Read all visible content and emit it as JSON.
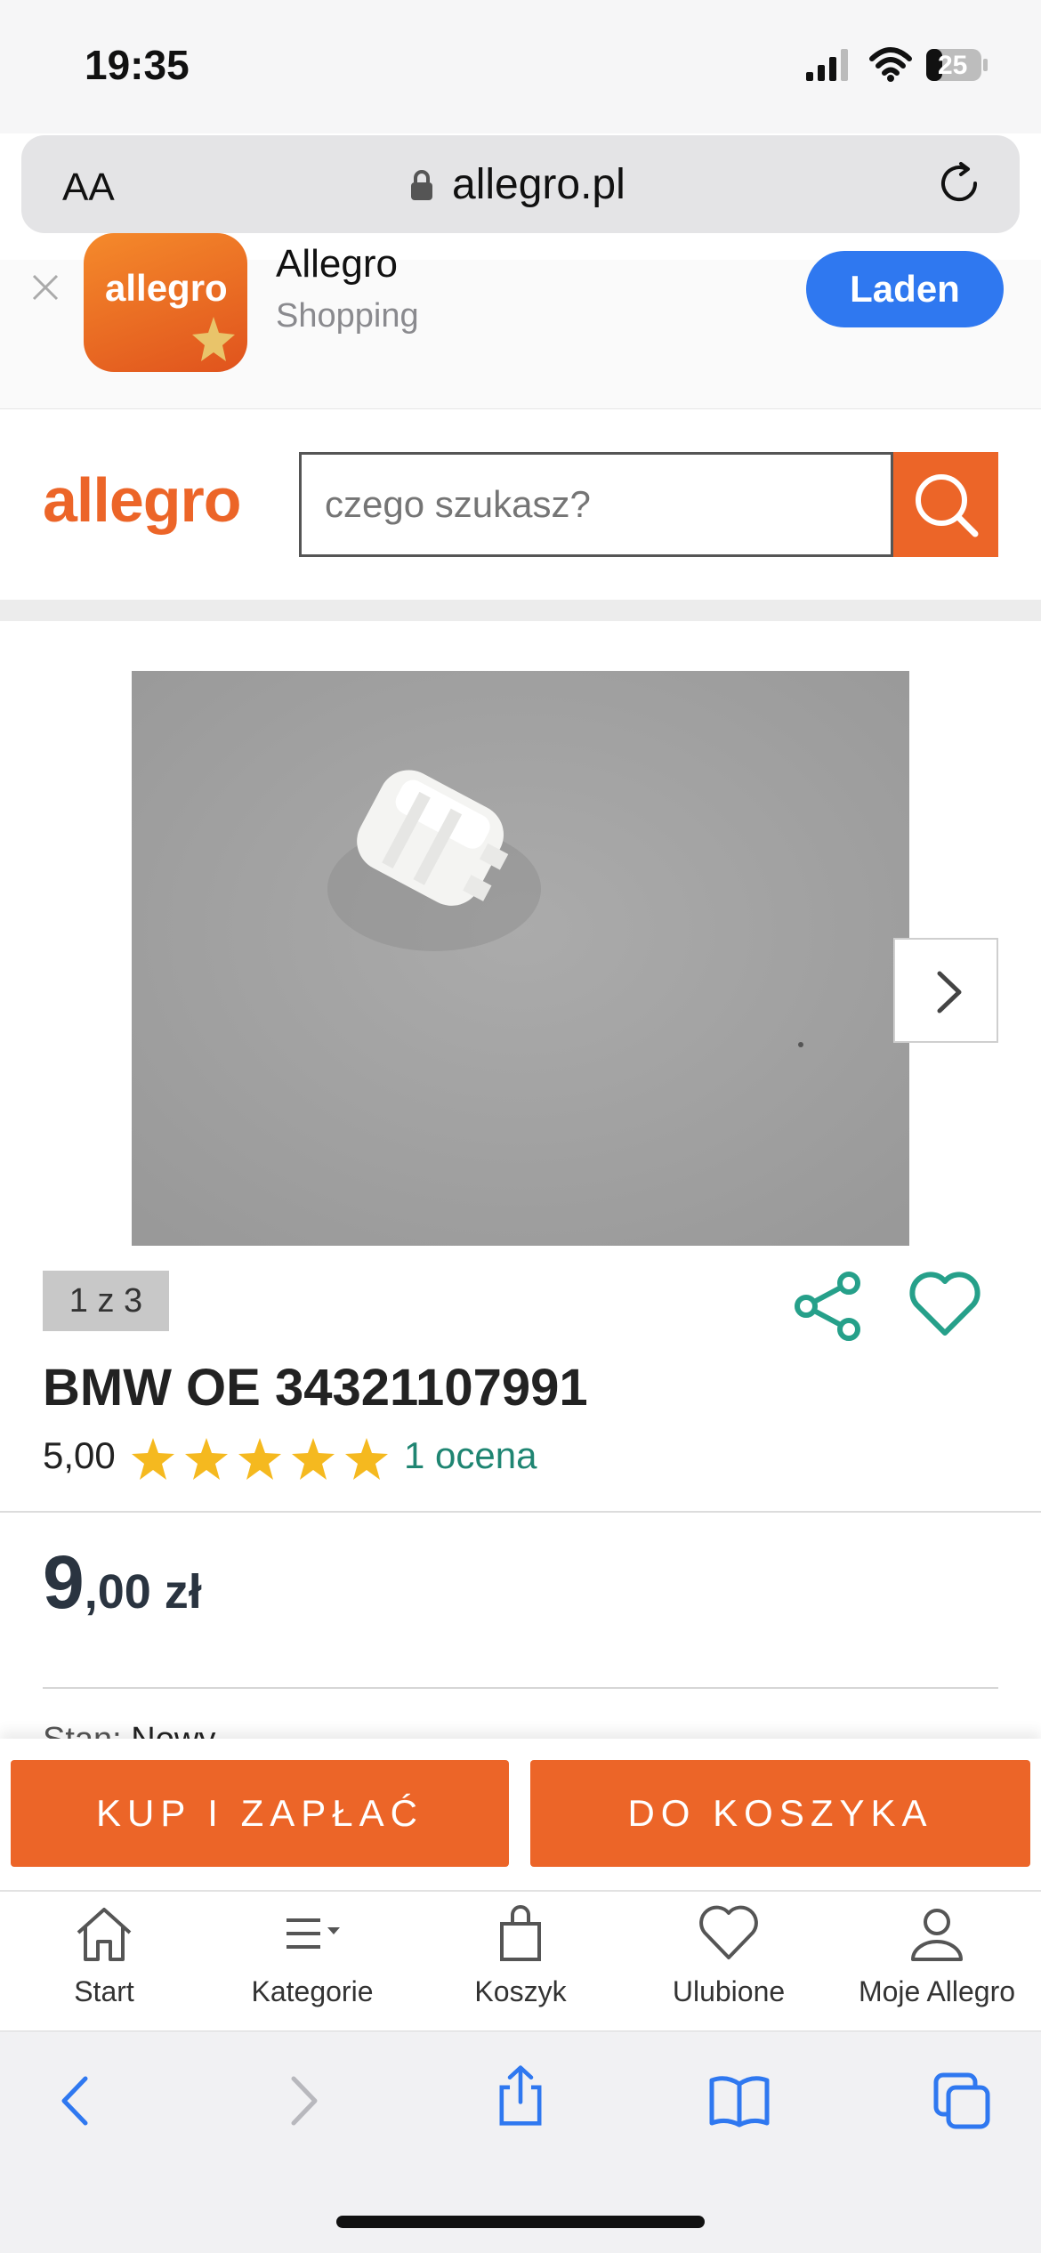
{
  "status": {
    "time": "19:35",
    "battery": "25"
  },
  "browser": {
    "text_size": "AA",
    "url": "allegro.pl"
  },
  "banner": {
    "app_logo": "allegro",
    "app_name": "Allegro",
    "category": "Shopping",
    "button": "Laden"
  },
  "header": {
    "logo": "allegro",
    "search_placeholder": "czego szukasz?"
  },
  "product": {
    "image_counter": "1 z 3",
    "title": "BMW OE 34321107991",
    "rating": "5,00",
    "stars": 5,
    "rating_count": "1 ocena",
    "price_main": "9",
    "price_rest": ",00 zł",
    "condition_label": "Stan:",
    "condition_value": "Nowy"
  },
  "actions": {
    "buy_now": "KUP I ZAPŁAĆ",
    "add_to_cart": "DO KOSZYKA"
  },
  "tabbar": [
    {
      "label": "Start",
      "icon": "home-icon"
    },
    {
      "label": "Kategorie",
      "icon": "menu-icon"
    },
    {
      "label": "Koszyk",
      "icon": "bag-icon"
    },
    {
      "label": "Ulubione",
      "icon": "heart-icon"
    },
    {
      "label": "Moje Allegro",
      "icon": "user-icon"
    }
  ],
  "colors": {
    "brand": "#ec6528",
    "accent": "#1f8572",
    "ios_blue": "#2f78f0"
  }
}
